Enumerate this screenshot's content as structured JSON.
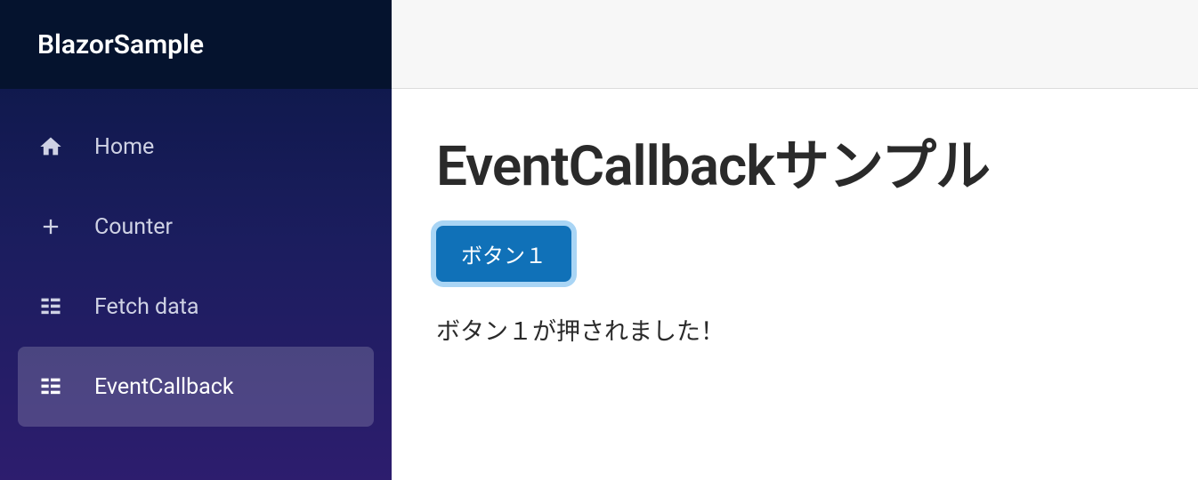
{
  "brand": "BlazorSample",
  "sidebar": {
    "items": [
      {
        "label": "Home",
        "icon": "home-icon",
        "active": false
      },
      {
        "label": "Counter",
        "icon": "plus-icon",
        "active": false
      },
      {
        "label": "Fetch data",
        "icon": "list-icon",
        "active": false
      },
      {
        "label": "EventCallback",
        "icon": "list-icon",
        "active": true
      }
    ]
  },
  "page": {
    "title": "EventCallbackサンプル",
    "button_label": "ボタン１",
    "message": "ボタン１が押されました！"
  }
}
